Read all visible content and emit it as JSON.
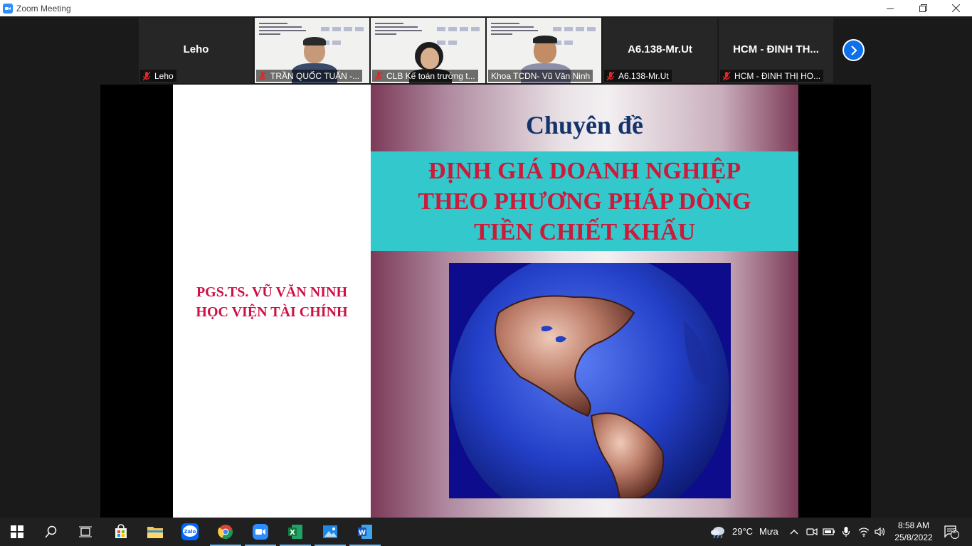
{
  "window": {
    "title": "Zoom Meeting",
    "controls": [
      "minimize",
      "restore",
      "close"
    ]
  },
  "participants": [
    {
      "display_name": "Leho",
      "label": "Leho",
      "muted": true,
      "video": false
    },
    {
      "display_name": "",
      "label": "TRẦN QUỐC TUẤN -...",
      "muted": true,
      "video": true
    },
    {
      "display_name": "",
      "label": "CLB Kế toán trưởng t...",
      "muted": true,
      "video": true
    },
    {
      "display_name": "",
      "label": "Khoa TCDN- Vũ Văn Ninh",
      "muted": false,
      "video": true,
      "active_speaker": true
    },
    {
      "display_name": "A6.138-Mr.Ut",
      "label": "A6.138-Mr.Ut",
      "muted": true,
      "video": false
    },
    {
      "display_name": "HCM - ĐINH TH...",
      "label": "HCM - ĐINH THỊ HO...",
      "muted": true,
      "video": false
    }
  ],
  "slide": {
    "author_line1": "PGS.TS. VŨ VĂN NINH",
    "author_line2": "HỌC VIỆN TÀI CHÍNH",
    "heading": "Chuyên đề",
    "title_line1": "ĐỊNH GIÁ DOANH NGHIỆP",
    "title_line2": "THEO PHƯƠNG PHÁP DÒNG",
    "title_line3": "TIỀN CHIẾT KHẤU",
    "image": "globe-americas"
  },
  "taskbar": {
    "apps": [
      "start-icon",
      "search-icon",
      "task-view-icon",
      "store-icon",
      "file-explorer-icon",
      "zalo-icon",
      "chrome-icon",
      "zoom-icon",
      "excel-icon",
      "photos-icon",
      "word-icon"
    ],
    "weather_temp": "29°C",
    "weather_desc": "Mưa",
    "time": "8:58 AM",
    "date": "25/8/2022",
    "notifications": "2"
  },
  "colors": {
    "zoom_blue": "#0e71eb",
    "slide_title_red": "#cc1a3a",
    "slide_band_cyan": "#33c8cc",
    "slide_heading_navy": "#14336b"
  }
}
